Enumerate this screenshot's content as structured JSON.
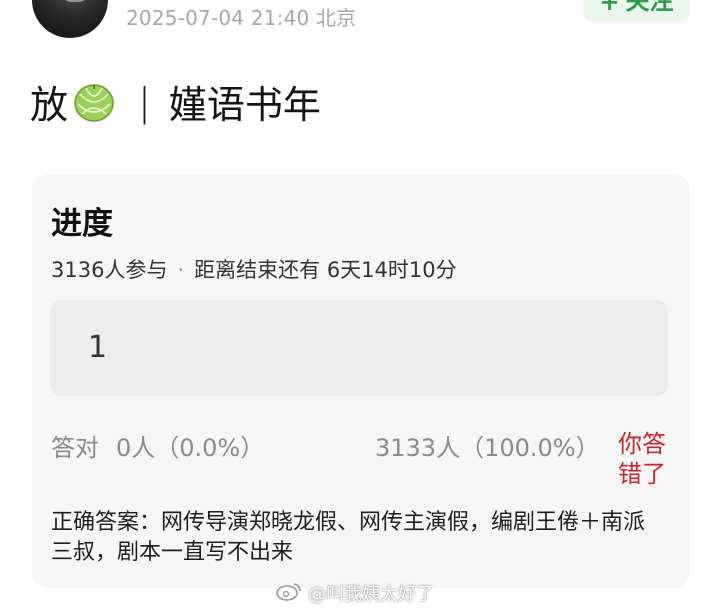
{
  "post_header": {
    "meta": "2025-07-04 21:40  北京",
    "follow_label": "关注",
    "follow_icon": "plus-icon"
  },
  "title": {
    "prefix": "放",
    "emoji": "melon-icon",
    "separator": "|",
    "suffix": "嫤语书年"
  },
  "poll": {
    "heading": "进度",
    "participants": "3136人参与",
    "separator": "·",
    "time_left": "距离结束还有 6天14时10分",
    "answer": "1",
    "correct_label": "答对",
    "correct_count": "0人（0.0%）",
    "wrong_count": "3133人（100.0%）",
    "wrong_label": "你答错了",
    "correct_answer": "正确答案：网传导演郑晓龙假、网传主演假，编剧王倦＋南派三叔，剧本一直写不出来"
  },
  "watermark": {
    "text": "@叫我姨太好了",
    "icon": "weibo-icon"
  },
  "colors": {
    "accent_green": "#2f9a49",
    "wrong_red": "#c8262a",
    "card_bg": "#f6f6f6"
  }
}
